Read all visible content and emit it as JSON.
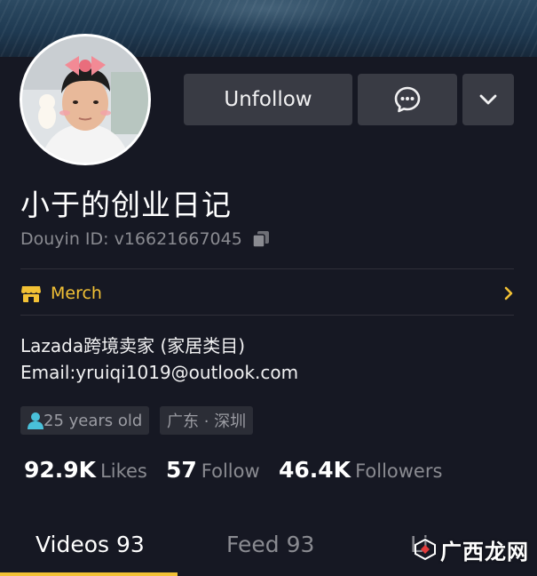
{
  "profile": {
    "name": "小于的创业日记",
    "douyin_id": "Douyin ID: v16621667045",
    "merch_label": "Merch",
    "bio_line1": "Lazada跨境卖家 (家居类目)",
    "bio_line2": "Email:yruiqi1019@outlook.com",
    "tags": {
      "age": "25 years old",
      "location": "广东 · 深圳"
    }
  },
  "actions": {
    "unfollow_label": "Unfollow",
    "message_icon": "message-icon",
    "more_icon": "chevron-down-icon"
  },
  "stats": {
    "likes_value": "92.9K",
    "likes_label": "Likes",
    "follow_value": "57",
    "follow_label": "Follow",
    "followers_value": "46.4K",
    "followers_label": "Followers"
  },
  "tabs": {
    "videos": "Videos 93",
    "feed": "Feed 93",
    "likes": "Li"
  },
  "watermark": "广西龙网",
  "colors": {
    "background": "#161823",
    "button": "#393b44",
    "accent": "#f2c135",
    "muted_text": "#8a8b91",
    "tag_bg": "#2b2d36"
  }
}
